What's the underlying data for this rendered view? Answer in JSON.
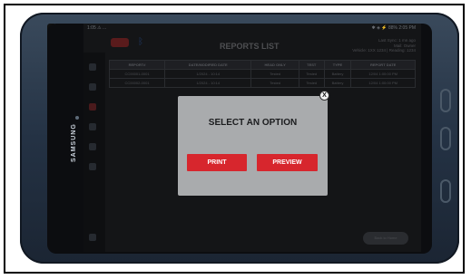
{
  "app": {
    "title": "REPORTS LIST",
    "status_left": "1:05 ⚠ ...",
    "status_right": "✱ ◈ ⚡ 88% 2:05 PM",
    "meta_lines": [
      "Last Sync: 1 mn ago",
      "Mail: Owner",
      "Vehicle: 1XX 1234 | Reading: 1234"
    ],
    "icons": {
      "back": "back-arrow-icon",
      "bluetooth": "bluetooth-icon",
      "close": "close-icon"
    }
  },
  "table": {
    "headers": [
      "REPORT#",
      "DATE/MODIFIED DATE",
      "HEAD ONLY",
      "TEST",
      "TYPE",
      "REPORT DATE"
    ],
    "rows": [
      [
        "CC00001-0001",
        "1/2024 - 10:14",
        "Tested",
        "Tested",
        "Battery",
        "12/04 1:00:00 PM"
      ],
      [
        "CC00002-0001",
        "1/2024 - 10:14",
        "Tested",
        "Tested",
        "Battery",
        "12/04 1:00:00 PM"
      ]
    ]
  },
  "modal": {
    "title": "SELECT AN OPTION",
    "print_label": "PRINT",
    "preview_label": "PREVIEW",
    "close_glyph": "X"
  },
  "footer": {
    "pill_label": "Back to Home"
  },
  "device": {
    "brand": "SAMSUNG"
  },
  "colors": {
    "accent": "#d7262d",
    "modal_bg": "#a9abad",
    "overlay": "#141517"
  }
}
